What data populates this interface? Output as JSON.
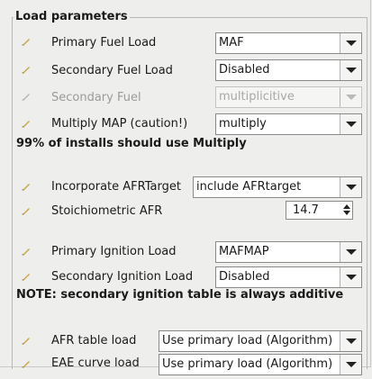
{
  "group_title": "Load parameters",
  "rows": {
    "primary_fuel_load": {
      "label": "Primary Fuel Load",
      "value": "MAF"
    },
    "secondary_fuel_load": {
      "label": "Secondary Fuel Load",
      "value": "Disabled"
    },
    "secondary_fuel": {
      "label": "Secondary Fuel",
      "value": "multiplicitive"
    },
    "multiply_map": {
      "label": "Multiply MAP (caution!)",
      "value": "multiply"
    },
    "incorporate_afr": {
      "label": "Incorporate AFRTarget",
      "value": "include AFRtarget"
    },
    "stoich_afr": {
      "label": "Stoichiometric AFR",
      "value": "14.7"
    },
    "primary_ignition_load": {
      "label": "Primary Ignition Load",
      "value": "MAFMAP"
    },
    "secondary_ignition_load": {
      "label": "Secondary Ignition Load",
      "value": "Disabled"
    },
    "afr_table_load": {
      "label": "AFR table load",
      "value": "Use primary load (Algorithm)"
    },
    "eae_curve_load": {
      "label": "EAE curve load",
      "value": "Use primary load (Algorithm)"
    }
  },
  "notes": {
    "multiply_note": "99% of installs should use Multiply",
    "ignition_note": "NOTE: secondary ignition table is always additive"
  },
  "icons": {
    "edit": "pencil-edit-icon",
    "edit_disabled": "pencil-edit-disabled-icon"
  }
}
